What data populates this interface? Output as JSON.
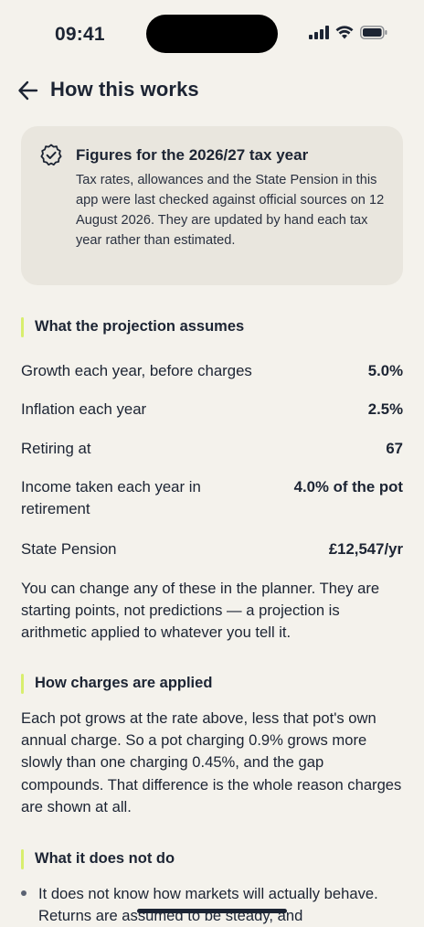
{
  "status": {
    "time": "09:41"
  },
  "header": {
    "title": "How this works"
  },
  "info_card": {
    "title": "Figures for the 2026/27 tax year",
    "body": "Tax rates, allowances and the State Pension in this app were last checked against official sources on 12 August 2026. They are updated by hand each tax year rather than estimated."
  },
  "assumptions": {
    "heading": "What the projection assumes",
    "rows": [
      {
        "label": "Growth each year, before charges",
        "value": "5.0%"
      },
      {
        "label": "Inflation each year",
        "value": "2.5%"
      },
      {
        "label": "Retiring at",
        "value": "67"
      },
      {
        "label": "Income taken each year in retirement",
        "value": "4.0% of the pot"
      },
      {
        "label": "State Pension",
        "value": "£12,547/yr"
      }
    ],
    "note": "You can change any of these in the planner. They are starting points, not predictions — a projection is arithmetic applied to whatever you tell it."
  },
  "charges": {
    "heading": "How charges are applied",
    "body": "Each pot grows at the rate above, less that pot's own annual charge. So a pot charging 0.9% grows more slowly than one charging 0.45%, and the gap compounds. That difference is the whole reason charges are shown at all."
  },
  "limits": {
    "heading": "What it does not do",
    "items": [
      "It does not know how markets will actually behave. Returns are assumed to be steady, and"
    ]
  },
  "icons": {
    "back": "arrow-left-icon",
    "badge": "verified-badge-icon",
    "signal": "signal-icon",
    "wifi": "wifi-icon",
    "battery": "battery-icon"
  },
  "colors": {
    "background": "#f4f2ec",
    "card": "#e9e6de",
    "accent": "#d8ee6e",
    "text": "#1c2433"
  }
}
